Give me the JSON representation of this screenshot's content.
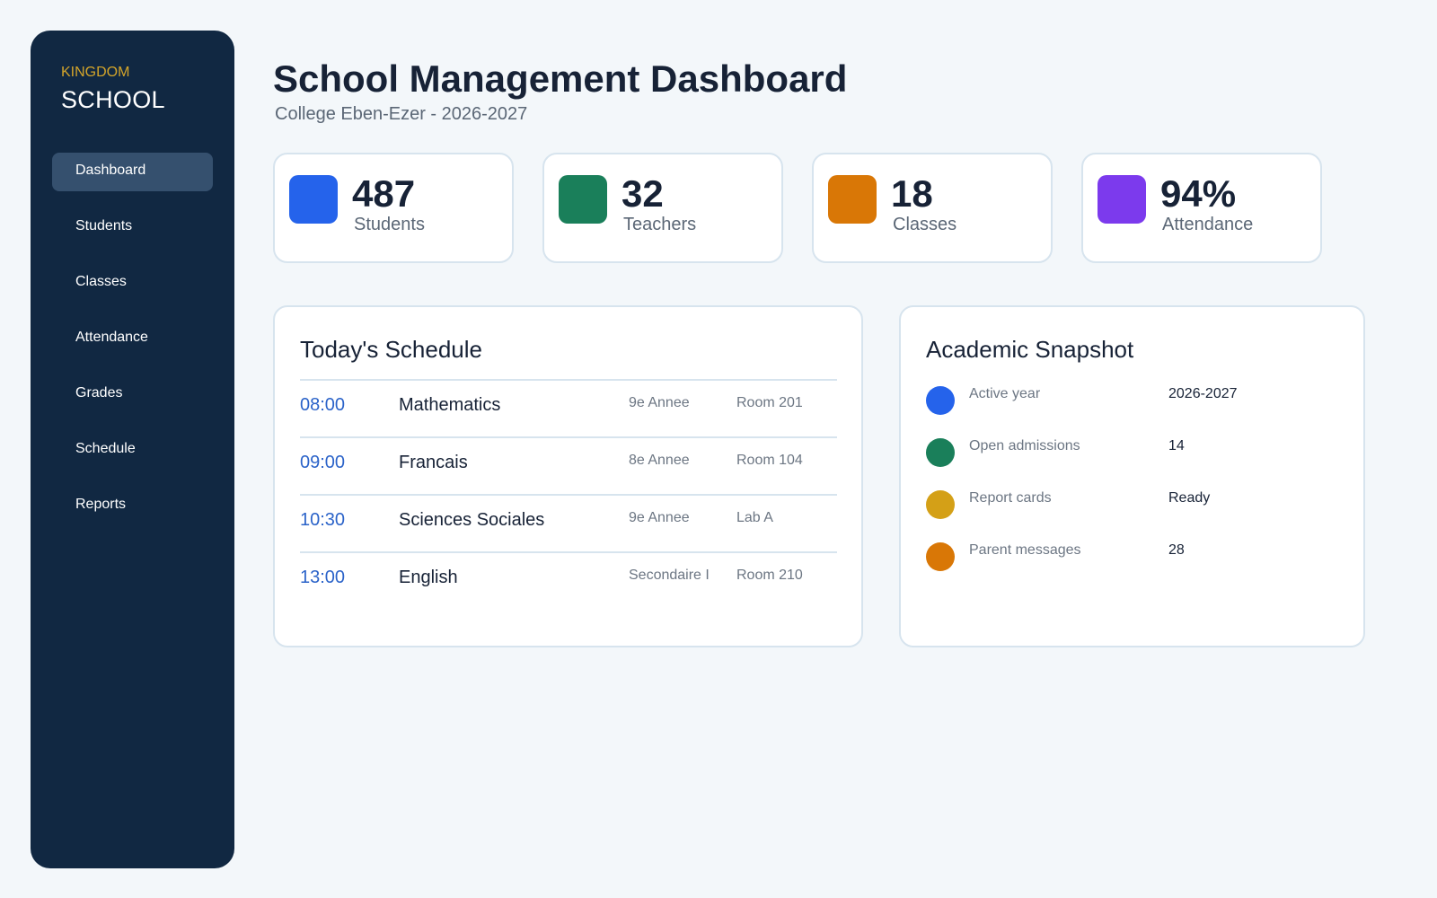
{
  "sidebar": {
    "brand_small": "KINGDOM",
    "brand_big": "SCHOOL",
    "items": [
      {
        "label": "Dashboard",
        "active": true
      },
      {
        "label": "Students",
        "active": false
      },
      {
        "label": "Classes",
        "active": false
      },
      {
        "label": "Attendance",
        "active": false
      },
      {
        "label": "Grades",
        "active": false
      },
      {
        "label": "Schedule",
        "active": false
      },
      {
        "label": "Reports",
        "active": false
      }
    ]
  },
  "header": {
    "title": "School Management Dashboard",
    "subtitle": "College Eben-Ezer - 2026-2027"
  },
  "stats": [
    {
      "value": "487",
      "label": "Students",
      "color": "#2563eb"
    },
    {
      "value": "32",
      "label": "Teachers",
      "color": "#1a7f5a"
    },
    {
      "value": "18",
      "label": "Classes",
      "color": "#d97706"
    },
    {
      "value": "94%",
      "label": "Attendance",
      "color": "#7c3aed"
    }
  ],
  "schedule": {
    "title": "Today's Schedule",
    "rows": [
      {
        "time": "08:00",
        "subject": "Mathematics",
        "grade": "9e Annee",
        "room": "Room 201"
      },
      {
        "time": "09:00",
        "subject": "Francais",
        "grade": "8e Annee",
        "room": "Room 104"
      },
      {
        "time": "10:30",
        "subject": "Sciences Sociales",
        "grade": "9e Annee",
        "room": "Lab A"
      },
      {
        "time": "13:00",
        "subject": "English",
        "grade": "Secondaire I",
        "room": "Room 210"
      }
    ]
  },
  "snapshot": {
    "title": "Academic Snapshot",
    "rows": [
      {
        "label": "Active year",
        "value": "2026-2027",
        "color": "#2563eb"
      },
      {
        "label": "Open admissions",
        "value": "14",
        "color": "#1a7f5a"
      },
      {
        "label": "Report cards",
        "value": "Ready",
        "color": "#d4a017"
      },
      {
        "label": "Parent messages",
        "value": "28",
        "color": "#d97706"
      }
    ]
  }
}
